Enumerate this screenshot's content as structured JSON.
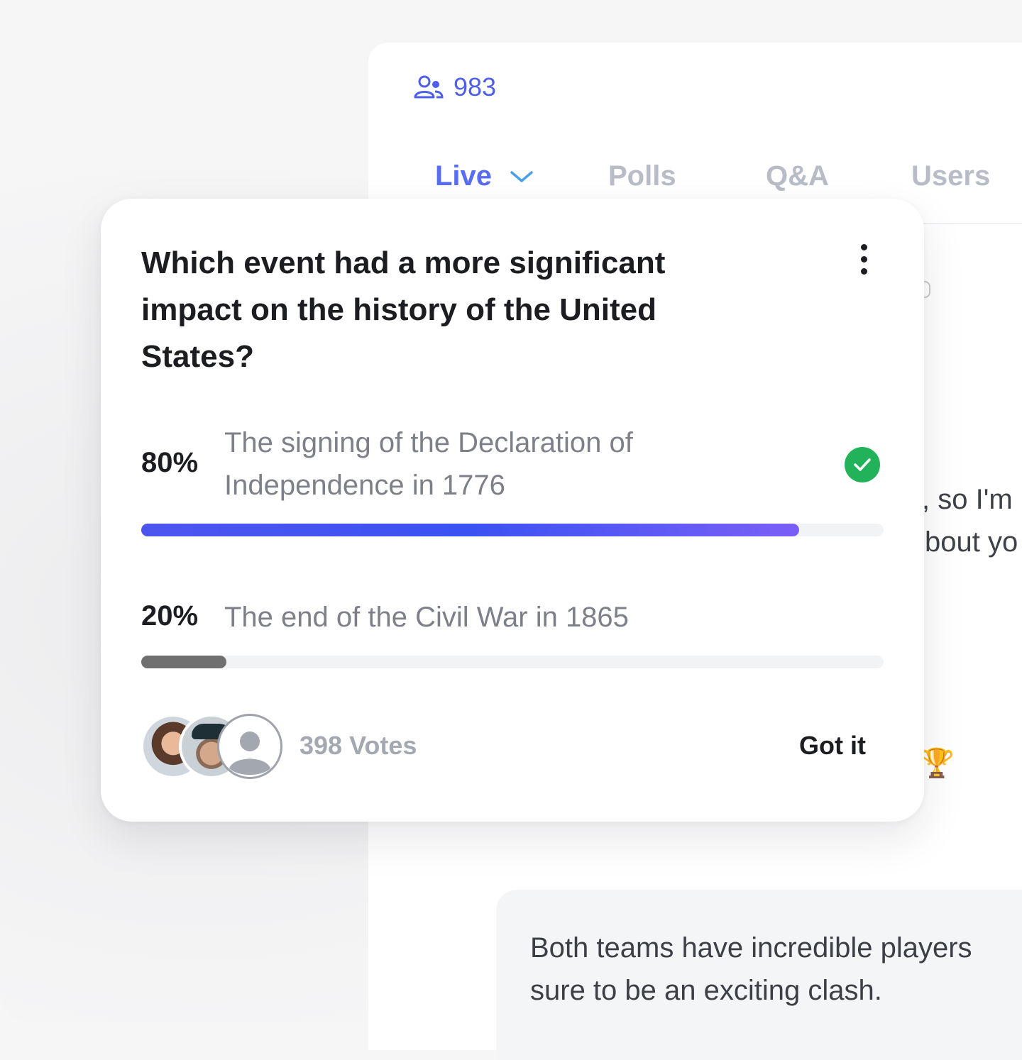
{
  "header": {
    "viewer_count": "983",
    "viewer_icon": "users-icon"
  },
  "tabs": [
    {
      "label": "Live",
      "active": true
    },
    {
      "label": "Polls",
      "active": false
    },
    {
      "label": "Q&A",
      "active": false
    },
    {
      "label": "Users",
      "active": false
    }
  ],
  "chat": {
    "fragment_1": ", so I'm",
    "fragment_2": "bout yo",
    "message_line_1": "Both teams have incredible players",
    "message_line_2": "sure to be an exciting clash."
  },
  "poll": {
    "question": "Which event had a more significant impact on the history of the United States?",
    "options": [
      {
        "percent_label": "80%",
        "text": "The signing of the Declaration of Independence in 1776",
        "fraction": 0.886,
        "selected": true
      },
      {
        "percent_label": "20%",
        "text": "The end of the Civil War in 1865",
        "fraction": 0.115,
        "selected": false
      }
    ],
    "votes_label": "398 Votes",
    "confirm_label": "Got it"
  },
  "colors": {
    "accent": "#5a6cf0",
    "check_green": "#22b35a",
    "winner_bar": "#3a52f2",
    "loser_bar": "#707070"
  }
}
